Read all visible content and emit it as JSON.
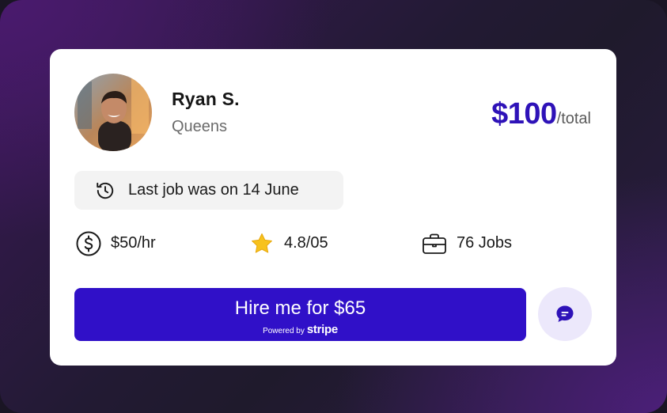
{
  "profile": {
    "name": "Ryan S.",
    "location": "Queens",
    "avatar_icon": "person-avatar"
  },
  "price": {
    "amount": "$100",
    "unit": "/total",
    "color": "#2e12b8"
  },
  "last_job": {
    "icon": "history-icon",
    "text": "Last job was on 14 June"
  },
  "stats": {
    "rate": {
      "icon": "dollar-circle-icon",
      "text": "$50/hr"
    },
    "rating": {
      "icon": "star-icon",
      "text": "4.8/05"
    },
    "jobs": {
      "icon": "briefcase-icon",
      "text": "76 Jobs"
    }
  },
  "hire_button": {
    "label": "Hire me for $65",
    "powered_by": "Powered by",
    "provider": "stripe",
    "color": "#3010c8"
  },
  "chat_button": {
    "icon": "chat-bubble-icon",
    "background": "#ece8fb"
  }
}
